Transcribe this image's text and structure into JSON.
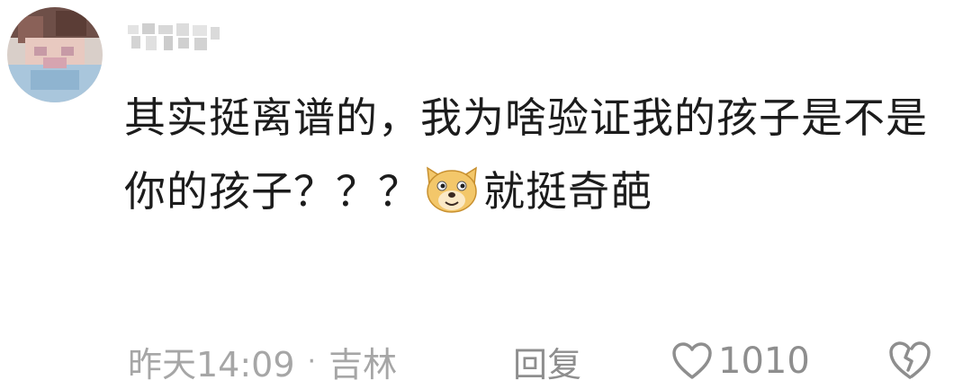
{
  "comment": {
    "username_display": "",
    "text_part1": "其实挺离谱的，我为啥验证我的孩子是不是你的孩子？？？",
    "emoji_name": "doge-emoji",
    "text_part2": "就挺奇葩",
    "time": "昨天14:09",
    "separator": "·",
    "location": "吉林",
    "reply_label": "回复",
    "like_count": "1010"
  },
  "icons": {
    "like": "heart-outline-icon",
    "dislike": "broken-heart-icon"
  },
  "colors": {
    "text": "#1c1c1c",
    "meta": "#a6a6a6",
    "action": "#8e8e8e",
    "emoji_face": "#f3c76a"
  }
}
